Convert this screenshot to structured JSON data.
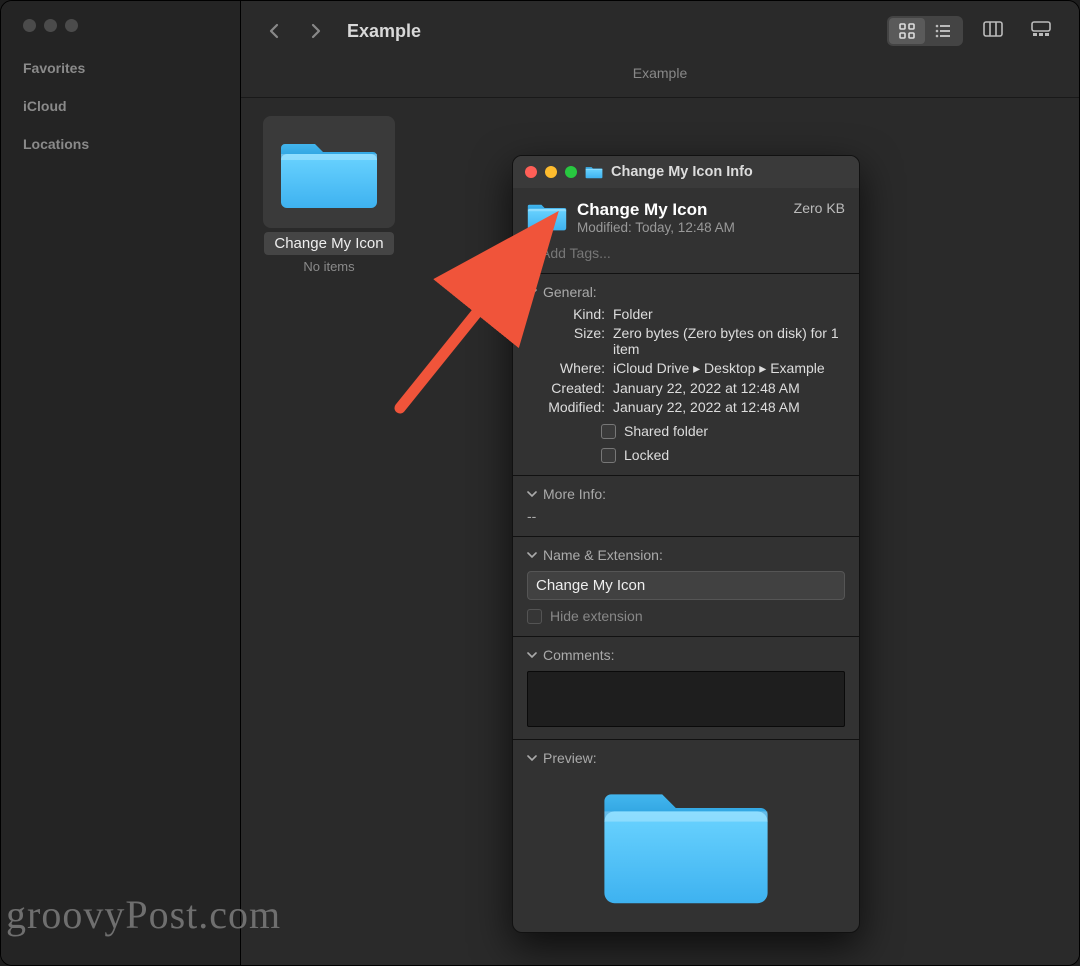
{
  "window": {
    "title": "Example",
    "path_label": "Example",
    "sidebar": {
      "sections": [
        "Favorites",
        "iCloud",
        "Locations"
      ]
    }
  },
  "item": {
    "name": "Change My Icon",
    "subtitle": "No items"
  },
  "info": {
    "titlebar": "Change My Icon Info",
    "name": "Change My Icon",
    "modified_line": "Modified: Today, 12:48 AM",
    "size_badge": "Zero KB",
    "tags_placeholder": "Add Tags...",
    "general": {
      "label": "General:",
      "kind_k": "Kind:",
      "kind_v": "Folder",
      "size_k": "Size:",
      "size_v": "Zero bytes (Zero bytes on disk) for 1 item",
      "where_k": "Where:",
      "where_v": "iCloud Drive ▸ Desktop ▸ Example",
      "created_k": "Created:",
      "created_v": "January 22, 2022 at 12:48 AM",
      "modified_k": "Modified:",
      "modified_v": "January 22, 2022 at 12:48 AM",
      "shared_label": "Shared folder",
      "locked_label": "Locked"
    },
    "moreinfo": {
      "label": "More Info:",
      "value": "--"
    },
    "nameext": {
      "label": "Name & Extension:",
      "value": "Change My Icon",
      "hide_label": "Hide extension"
    },
    "comments": {
      "label": "Comments:"
    },
    "preview": {
      "label": "Preview:"
    }
  },
  "watermark": "groovyPost.com"
}
